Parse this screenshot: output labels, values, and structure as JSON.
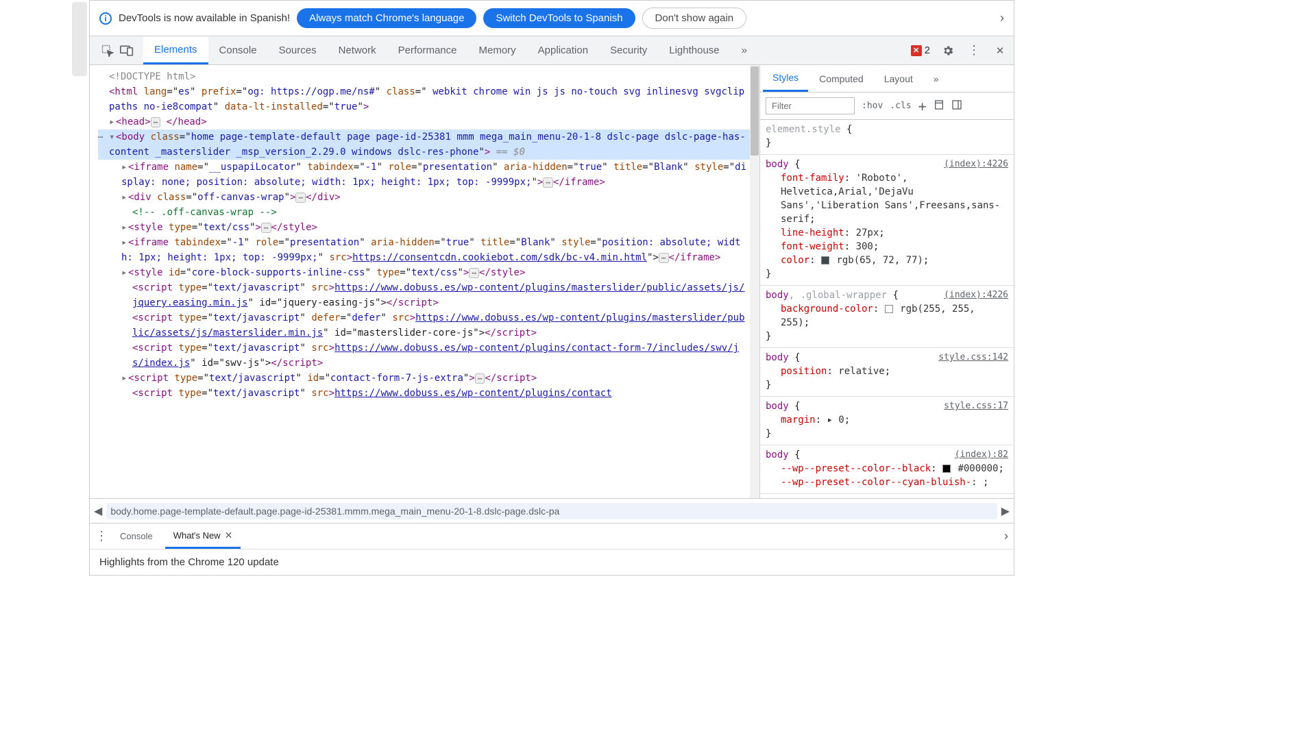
{
  "banner": {
    "text": "DevTools is now available in Spanish!",
    "btn1": "Always match Chrome's language",
    "btn2": "Switch DevTools to Spanish",
    "btn3": "Don't show again"
  },
  "tabs": [
    "Elements",
    "Console",
    "Sources",
    "Network",
    "Performance",
    "Memory",
    "Application",
    "Security",
    "Lighthouse"
  ],
  "active_tab": "Elements",
  "errors_count": "2",
  "dom": {
    "doctype": "<!DOCTYPE html>",
    "html_open": "<html lang=\"es\" prefix=\"og: https://ogp.me/ns#\" class=\" webkit chrome win js js no-touch svg inlinesvg svgclippaths no-ie8compat\" data-lt-installed=\"true\">",
    "head": "<head>…</head>",
    "body_open": "<body class=\"home page-template-default page page-id-25381 mmm mega_main_menu-20-1-8 dslc-page dslc-page-has-content _masterslider _msp_version_2.29.0 windows dslc-res-phone\">",
    "eq0": " == $0",
    "iframe1": "<iframe name=\"__uspapiLocator\" tabindex=\"-1\" role=\"presentation\" aria-hidden=\"true\" title=\"Blank\" style=\"display: none; position: absolute; width: 1px; height: 1px; top: -9999px;\">…</iframe>",
    "div_offcanvas": "<div class=\"off-canvas-wrap\">…</div>",
    "comment": "<!-- .off-canvas-wrap -->",
    "style1": "<style type=\"text/css\">…</style>",
    "iframe2_a": "<iframe tabindex=\"-1\" role=\"presentation\" aria-hidden=\"true\" title=\"Blank\" style=\"position: absolute; width: 1px; height: 1px; top: -9999px;\" src=\"",
    "iframe2_link": "https://consentcdn.cookiebot.com/sdk/bc-v4.min.html",
    "iframe2_b": "\">…</iframe>",
    "style2": "<style id=\"core-block-supports-inline-css\" type=\"text/css\">…</style>",
    "script1_a": "<script type=\"text/javascript\" src=\"",
    "script1_link": "https://www.dobuss.es/wp-content/plugins/masterslider/public/assets/js/jquery.easing.min.js",
    "script1_b": "\" id=\"jquery-easing-js\"></script>",
    "script2_a": "<script type=\"text/javascript\" defer=\"defer\" src=\"",
    "script2_link": "https://www.dobuss.es/wp-content/plugins/masterslider/public/assets/js/masterslider.min.js",
    "script2_b": "\" id=\"masterslider-core-js\"></script>",
    "script3_a": "<script type=\"text/javascript\" src=\"",
    "script3_link": "https://www.dobuss.es/wp-content/plugins/contact-form-7/includes/swv/js/index.js",
    "script3_b": "\" id=\"swv-js\"></script>",
    "script4": "<script type=\"text/javascript\" id=\"contact-form-7-js-extra\">…</script>",
    "script5_a": "<script type=\"text/javascript\" src=\"",
    "script5_link": "https://www.dobuss.es/wp-content/plugins/contact"
  },
  "breadcrumb": "body.home.page-template-default.page.page-id-25381.mmm.mega_main_menu-20-1-8.dslc-page.dslc-pa",
  "styles": {
    "tabs": [
      "Styles",
      "Computed",
      "Layout"
    ],
    "active": "Styles",
    "filter_ph": "Filter",
    "hov": ":hov",
    "cls": ".cls",
    "rules": [
      {
        "selector": "element.style",
        "src": "",
        "decls": []
      },
      {
        "selector": "body",
        "src": "(index):4226",
        "decls": [
          {
            "p": "font-family",
            "v": "'Roboto', Helvetica,Arial,'DejaVu Sans','Liberation Sans',Freesans,sans-serif"
          },
          {
            "p": "line-height",
            "v": "27px"
          },
          {
            "p": "font-weight",
            "v": "300"
          },
          {
            "p": "color",
            "v": "rgb(65, 72, 77)",
            "sw": "grey"
          }
        ]
      },
      {
        "selector": "body, .global-wrapper",
        "inherit": ".global-wrapper",
        "src": "(index):4226",
        "decls": [
          {
            "p": "background-color",
            "v": "rgb(255, 255, 255)",
            "sw": "white"
          }
        ]
      },
      {
        "selector": "body",
        "src": "style.css:142",
        "decls": [
          {
            "p": "position",
            "v": "relative"
          }
        ]
      },
      {
        "selector": "body",
        "src": "style.css:17",
        "decls": [
          {
            "p": "margin",
            "v": "▸ 0"
          }
        ]
      },
      {
        "selector": "body",
        "src": "(index):82",
        "decls": [
          {
            "p": "--wp--preset--color--black",
            "v": "#000000",
            "sw": "black"
          },
          {
            "p": "--wp--preset--color--cyan-bluish-",
            "v": "",
            "partial": true
          }
        ]
      }
    ]
  },
  "drawer": {
    "tabs": [
      "Console",
      "What's New"
    ],
    "active": "What's New",
    "body": "Highlights from the Chrome 120 update"
  }
}
